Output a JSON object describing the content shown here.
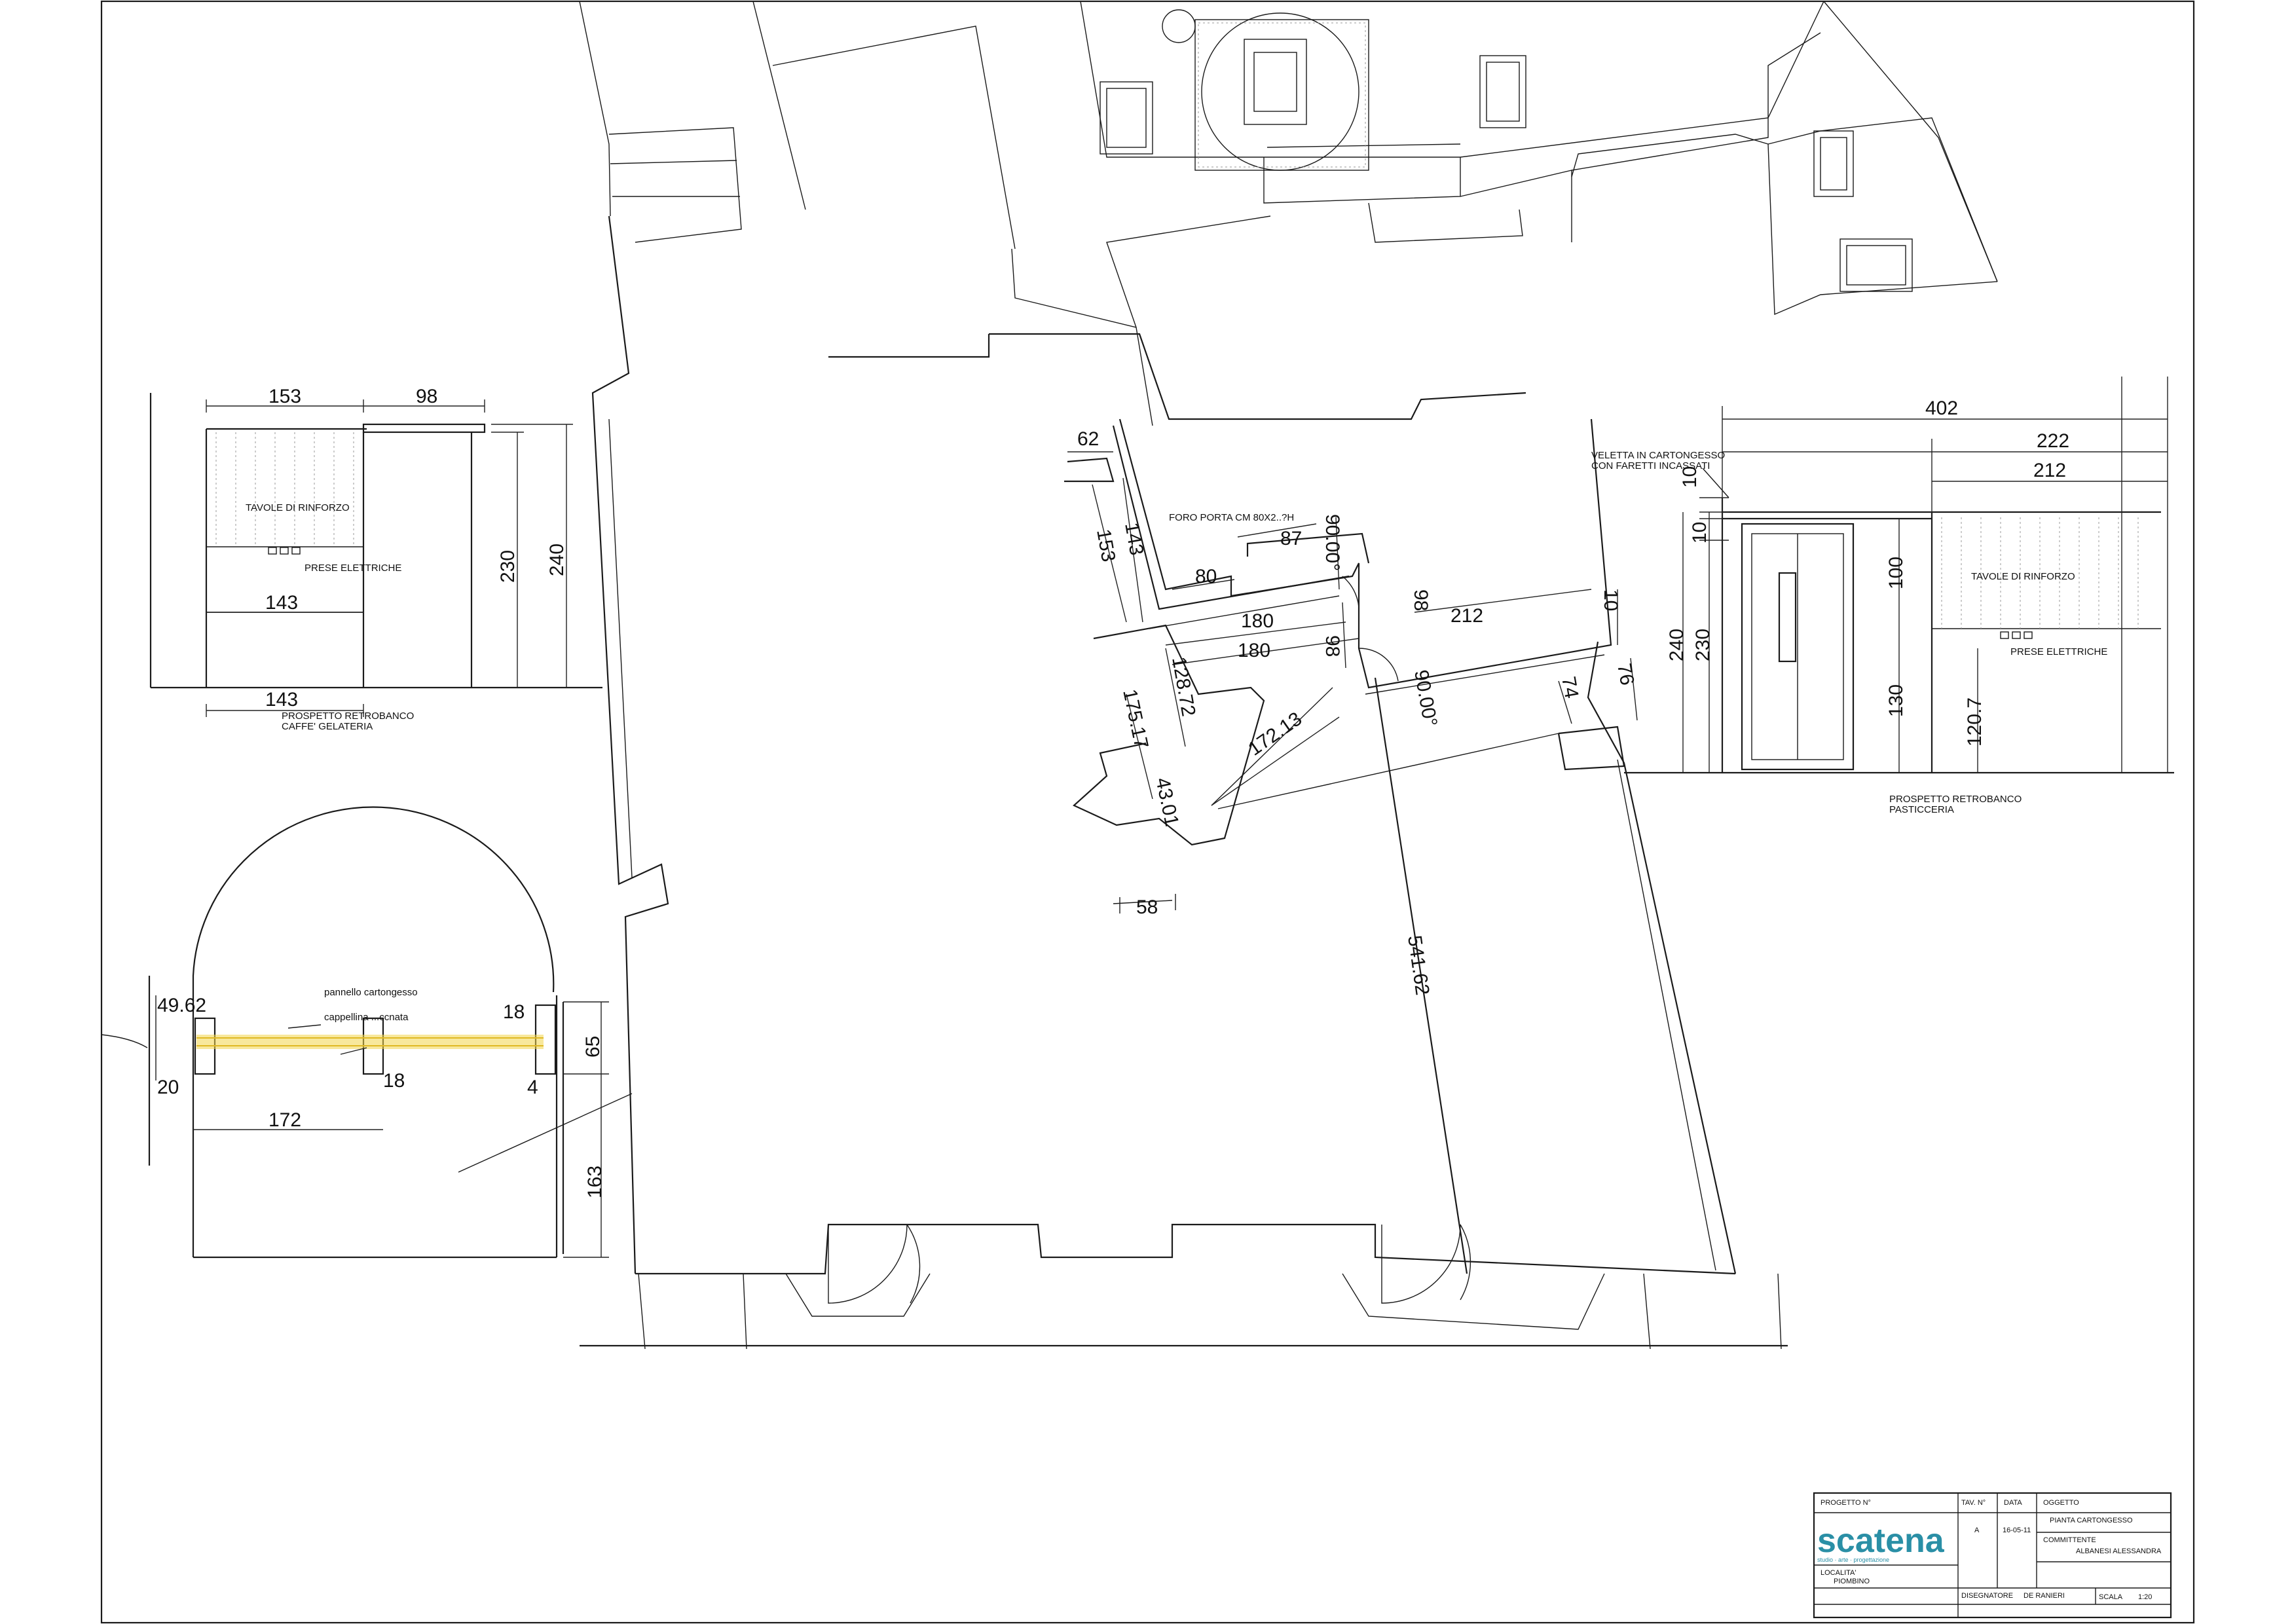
{
  "dimensions": {
    "d153_top": "153",
    "d98_top": "98",
    "d230_left": "230",
    "d240_left": "240",
    "d143_mid": "143",
    "d143_bot": "143",
    "d62": "62",
    "d143_v": "143",
    "d153_v": "153",
    "d87": "87",
    "d80": "80",
    "d90deg_1": "90.00°",
    "d98_a": "98",
    "d212": "212",
    "d180_a": "180",
    "d180_b": "180",
    "d98_b": "98",
    "d10": "10",
    "d128": "128.72",
    "d90deg_2": "90.00°",
    "d74": "74",
    "d76": "76",
    "d175": "175.17",
    "d172": "172.13",
    "d430": "43.01",
    "d58": "58",
    "d541": "541.62",
    "d402": "402",
    "d222": "222",
    "d212_r": "212",
    "d10_r1": "10",
    "d10_r2": "10",
    "d100": "100",
    "d240_r": "240",
    "d230_r": "230",
    "d130": "130",
    "d1207": "120.7",
    "d4962": "49.62",
    "d18_a": "18",
    "d65": "65",
    "d20": "20",
    "d18_b": "18",
    "d4": "4",
    "d172_b": "172",
    "d163": "163"
  },
  "labels": {
    "tavole_left": "TAVOLE DI RINFORZO",
    "prese_left": "PRESE ELETTRICHE",
    "prospetto_left_1": "PROSPETTO RETROBANCO",
    "prospetto_left_2": "CAFFE' GELATERIA",
    "foro_porta": "FORO PORTA CM 80X2..?H",
    "veletta_1": "VELETTA IN CARTONGESSO",
    "veletta_2": "CON FARETTI INCASSATI",
    "tavole_right": "TAVOLE DI RINFORZO",
    "prese_right": "PRESE ELETTRICHE",
    "prospetto_right_1": "PROSPETTO RETROBANCO",
    "prospetto_right_2": "PASTICCERIA",
    "pannello": "pannello cartongesso",
    "cappellina": "cappellina ...ccnata"
  },
  "title_block": {
    "logo_text": "scatena",
    "logo_sub": "studio · arte · progettazione",
    "progetto_label": "PROGETTO N°",
    "tav_label": "TAV. N°",
    "tav_value": "A",
    "data_label": "DATA",
    "data_value": "16-05-11",
    "oggetto_label": "OGGETTO",
    "oggetto_value": "PIANTA CARTONGESSO",
    "committente_label": "COMMITTENTE",
    "committente_value": "ALBANESI ALESSANDRA",
    "localita_label": "LOCALITA'",
    "localita_value": "PIOMBINO",
    "disegnatore_label": "DISEGNATORE",
    "disegnatore_value": "DE RANIERI",
    "scala_label": "SCALA",
    "scala_value": "1:20"
  },
  "colors": {
    "line": "#1a1a1a",
    "highlight": "#f2d64b",
    "logo_teal": "#2a8fa6"
  }
}
